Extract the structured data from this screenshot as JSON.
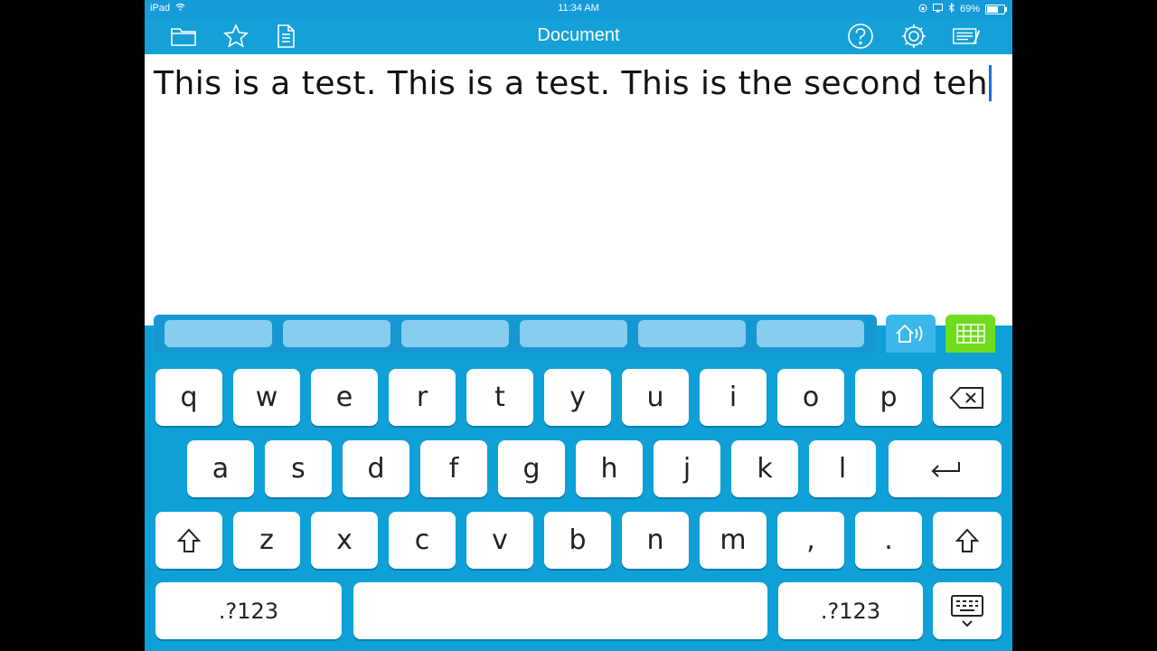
{
  "status": {
    "device": "iPad",
    "time": "11:34 AM",
    "battery": "69%",
    "battery_level": 0.69
  },
  "nav": {
    "title": "Document",
    "icons": [
      "folder-icon",
      "star-icon",
      "document-icon",
      "help-icon",
      "gear-icon",
      "keyboard-edit-icon"
    ]
  },
  "document": {
    "text": "This is a test. This is a test. This is the second teh"
  },
  "prediction": {
    "slots": [
      "",
      "",
      "",
      "",
      "",
      ""
    ]
  },
  "keyboard": {
    "row1": [
      "q",
      "w",
      "e",
      "r",
      "t",
      "y",
      "u",
      "i",
      "o",
      "p"
    ],
    "row2": [
      "a",
      "s",
      "d",
      "f",
      "g",
      "h",
      "j",
      "k",
      "l"
    ],
    "row3": [
      "z",
      "x",
      "c",
      "v",
      "b",
      "n",
      "m",
      ",",
      "."
    ],
    "numbers_label": ".?123",
    "numbers_label_right": ".?123"
  },
  "colors": {
    "accent": "#0ea0d6",
    "nav": "#15a1d8",
    "toggle": "#6fdc1e",
    "caret": "#1a6fd6"
  }
}
